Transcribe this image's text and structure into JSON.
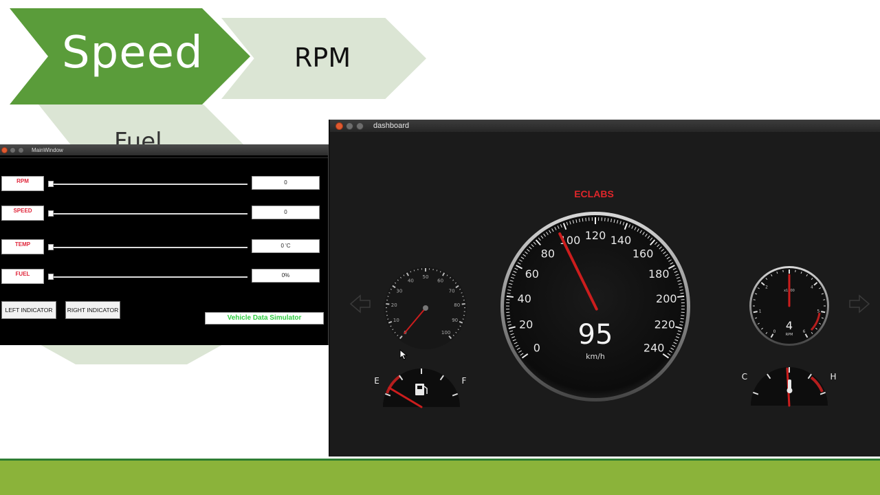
{
  "slide": {
    "tabs": [
      "Speed",
      "RPM",
      "Fuel"
    ],
    "colors": {
      "active": "#5a9c3a",
      "inactive": "#dbe5d4",
      "band": "#8bb33a"
    }
  },
  "main_window": {
    "title": "MainWindow",
    "controls": [
      {
        "label": "RPM",
        "value": "0"
      },
      {
        "label": "SPEED",
        "value": "0"
      },
      {
        "label": "TEMP",
        "value": "0 'C"
      },
      {
        "label": "FUEL",
        "value": "0%"
      }
    ],
    "buttons": {
      "left": "LEFT INDICATOR",
      "right": "RIGHT INDICATOR"
    },
    "simulator_label": "Vehicle Data Simulator"
  },
  "dashboard": {
    "title": "dashboard",
    "brand": "ECLABS",
    "speedometer": {
      "value": "95",
      "unit": "km/h",
      "ticks": [
        "0",
        "20",
        "40",
        "60",
        "80",
        "100",
        "120",
        "140",
        "160",
        "180",
        "200",
        "220",
        "240"
      ],
      "needle_kmh": 95
    },
    "small_gauge": {
      "ticks": [
        "0",
        "10",
        "20",
        "30",
        "40",
        "50",
        "60",
        "70",
        "80",
        "90",
        "100"
      ],
      "needle_value": 0
    },
    "rpm_gauge": {
      "value": "4",
      "unit": "RPM",
      "scale_label": "x1000",
      "ticks": [
        "0",
        "1",
        "2",
        "3",
        "4",
        "5",
        "6"
      ]
    },
    "fuel_gauge": {
      "empty_label": "E",
      "full_label": "F",
      "level": 0
    },
    "temp_gauge": {
      "cold_label": "C",
      "hot_label": "H",
      "level": 0.5
    },
    "colors": {
      "needle": "#cc1d1d",
      "brand": "#e0262a",
      "face": "#111111"
    }
  }
}
